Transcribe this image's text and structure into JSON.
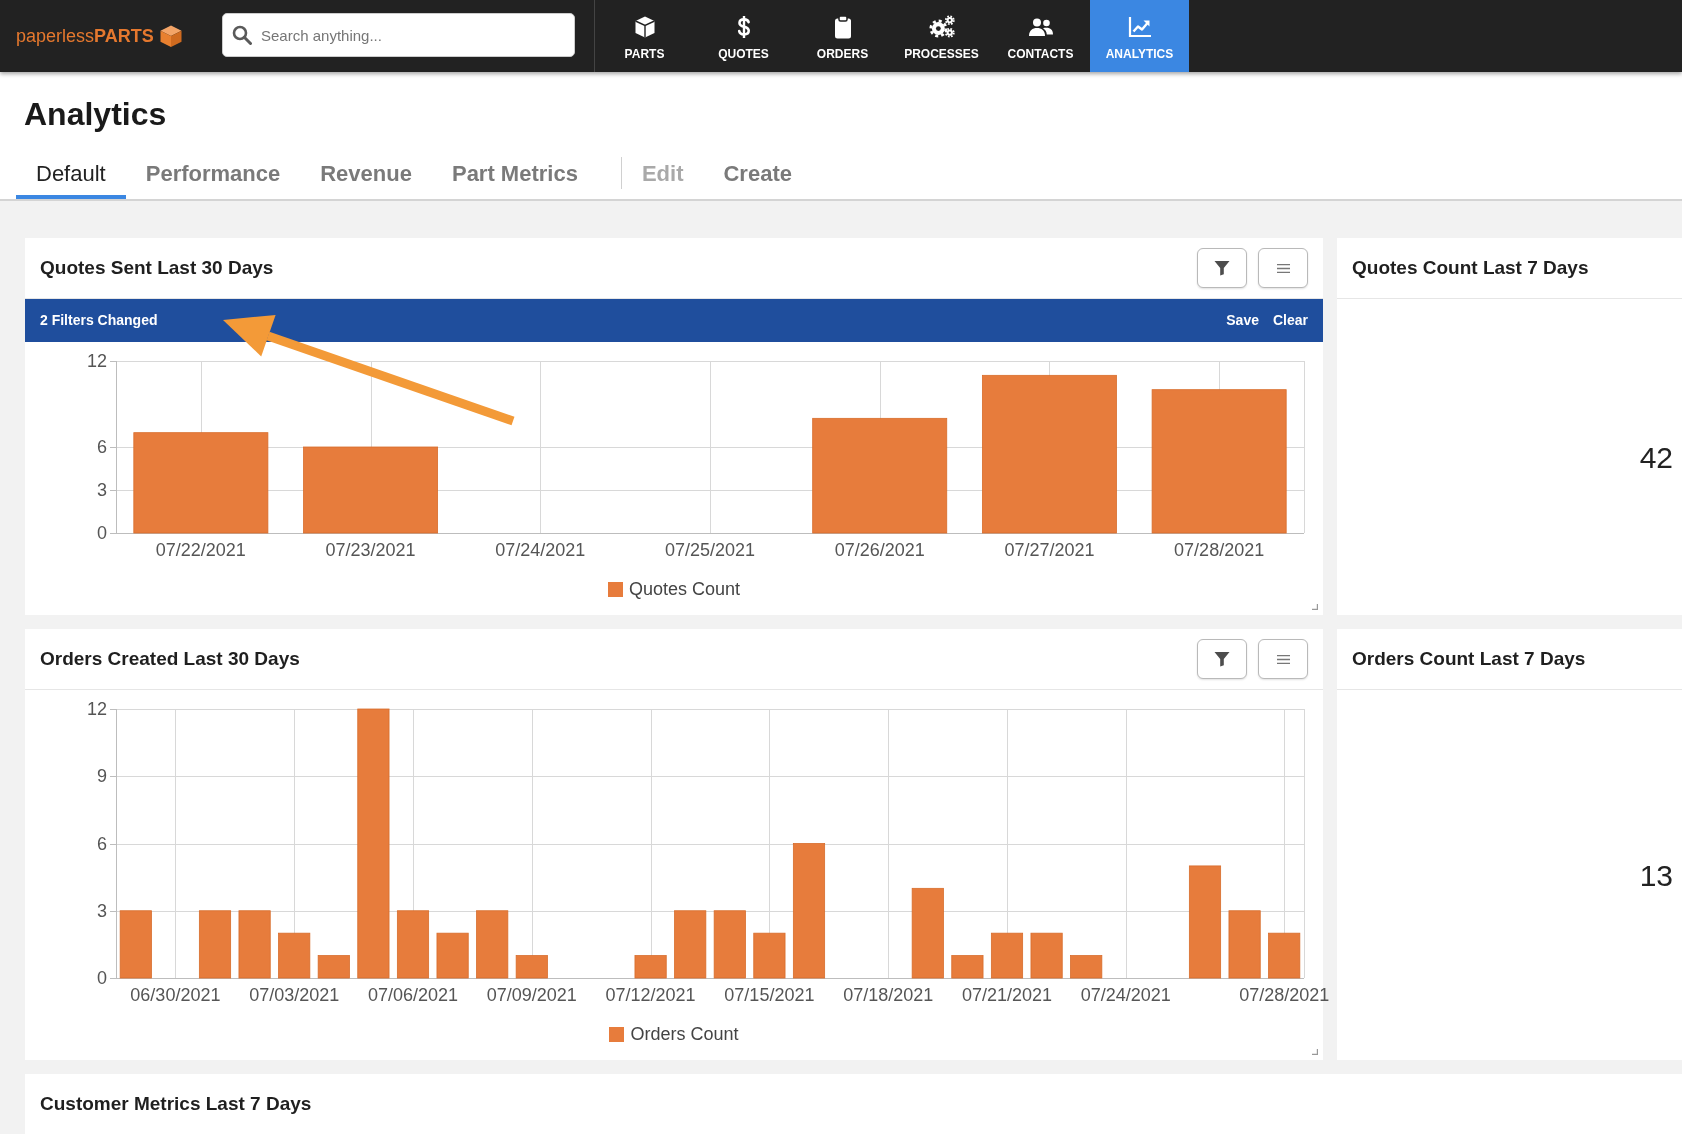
{
  "app_bar": {
    "logo": {
      "text": "paperless**PARTS**"
    },
    "search": {
      "placeholder": "Search anything..."
    },
    "nav": [
      {
        "label": "PARTS",
        "selected": false
      },
      {
        "label": "QUOTES",
        "selected": false
      },
      {
        "label": "ORDERS",
        "selected": false
      },
      {
        "label": "PROCESSES",
        "selected": false
      },
      {
        "label": "CONTACTS",
        "selected": false
      },
      {
        "label": "ANALYTICS",
        "selected": true
      }
    ]
  },
  "page": {
    "title": "Analytics",
    "tabs": [
      {
        "label": "Default",
        "selected": true
      },
      {
        "label": "Performance",
        "selected": false
      },
      {
        "label": "Revenue",
        "selected": false
      },
      {
        "label": "Part Metrics",
        "selected": false
      }
    ],
    "actions": [
      {
        "label": "Edit",
        "disabled": true
      },
      {
        "label": "Create",
        "disabled": false
      }
    ]
  },
  "widgets": [
    {
      "kind": "chart",
      "title": "Quotes Sent Last 30 Days",
      "filter_banner": {
        "message": "2 Filters Changed",
        "actions": [
          "Save",
          "Clear"
        ]
      },
      "chart_data": {
        "type": "bar",
        "categories": [
          "07/22/2021",
          "07/23/2021",
          "07/24/2021",
          "07/25/2021",
          "07/26/2021",
          "07/27/2021",
          "07/28/2021"
        ],
        "series": [
          {
            "name": "Quotes Count",
            "color": "#e77c3c",
            "values": [
              7,
              6,
              0,
              0,
              8,
              11,
              10
            ]
          }
        ],
        "ylim": [
          0,
          12
        ],
        "yticks": [
          0,
          3,
          6,
          12
        ],
        "grid": true
      }
    },
    {
      "kind": "count",
      "title": "Quotes Count Last 7 Days",
      "value": "42"
    },
    {
      "kind": "chart",
      "title": "Orders Created Last 30 Days",
      "chart_data": {
        "type": "bar",
        "categories": [
          null,
          "06/30/2021",
          null,
          null,
          "07/03/2021",
          null,
          null,
          "07/06/2021",
          null,
          null,
          "07/09/2021",
          null,
          null,
          "07/12/2021",
          null,
          null,
          "07/15/2021",
          null,
          null,
          "07/18/2021",
          null,
          null,
          "07/21/2021",
          null,
          null,
          "07/24/2021",
          null,
          null,
          null,
          "07/28/2021"
        ],
        "series": [
          {
            "name": "Orders Count",
            "color": "#e77c3c",
            "values": [
              3,
              0,
              3,
              3,
              2,
              1,
              12,
              3,
              2,
              3,
              1,
              0,
              0,
              1,
              3,
              3,
              2,
              6,
              0,
              0,
              4,
              1,
              2,
              2,
              1,
              0,
              0,
              5,
              3,
              2
            ]
          }
        ],
        "ylim": [
          0,
          12
        ],
        "yticks": [
          0,
          3,
          6,
          9,
          12
        ],
        "grid": true
      }
    },
    {
      "kind": "count",
      "title": "Orders Count Last 7 Days",
      "value": "13"
    },
    {
      "kind": "section",
      "title": "Customer Metrics Last 7 Days"
    }
  ]
}
